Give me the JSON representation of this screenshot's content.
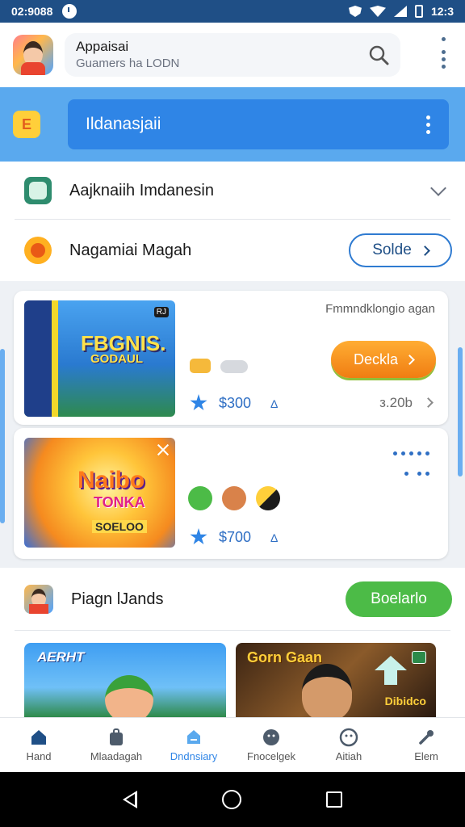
{
  "status_bar": {
    "time": "02:9088",
    "clock_right": "12:3"
  },
  "header": {
    "app_title": "Appaisai",
    "app_subtitle": "Guamers ha LODN",
    "icons": [
      "avatar",
      "search-icon",
      "more-vert-icon"
    ]
  },
  "banner": {
    "label": "Ildanasjaii",
    "icon": "app-icon"
  },
  "rows": {
    "first": {
      "title": "Aajknaiih Imdanesin",
      "icon": "chat-icon"
    },
    "second": {
      "title": "Nagamiai Magah",
      "button": "Solde",
      "icon": "flame-icon"
    }
  },
  "cards": [
    {
      "thumb_title": "FBGNIS.",
      "thumb_sub": "GODAUL",
      "thumb_badge": "RJ",
      "top_label": "Fmmndklongio agan",
      "button": "Deckla",
      "price": "$300",
      "rating_glyph": "Δ",
      "meta": "з.20b"
    },
    {
      "thumb_title": "Naibo",
      "thumb_mid": "TONKA",
      "thumb_bottom": "SOELOO",
      "price": "$700",
      "rating_glyph": "Δ"
    }
  ],
  "section": {
    "title": "Piagn lJands",
    "button": "Boelarlo"
  },
  "tiles": [
    {
      "title": "AERHT"
    },
    {
      "title": "Gorn Gaan",
      "label": "Dibidco",
      "badge": "N"
    }
  ],
  "bottom_nav": [
    {
      "label": "Hand",
      "icon": "home-icon",
      "active": false
    },
    {
      "label": "Mlaadagah",
      "icon": "bag-icon",
      "active": false
    },
    {
      "label": "Dndnsiary",
      "icon": "tag-icon",
      "active": true
    },
    {
      "label": "Fnocelgek",
      "icon": "face-icon",
      "active": false
    },
    {
      "label": "Aitiah",
      "icon": "smile-icon",
      "active": false
    },
    {
      "label": "Elem",
      "icon": "wrench-icon",
      "active": false
    }
  ],
  "colors": {
    "accent": "#2f85e6",
    "orange": "#f5901f",
    "green": "#4cbb47",
    "status_bar": "#1f4f86"
  }
}
